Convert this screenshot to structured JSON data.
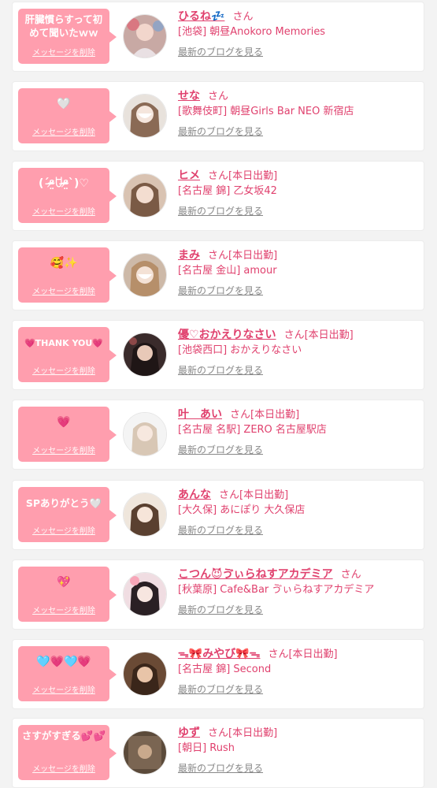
{
  "delete_label": "メッセージを削除",
  "blog_label": "最新のブログを見る",
  "items": [
    {
      "message": "肝臓慣らすって初めて聞いたｗｗ",
      "name": "ひるね💤",
      "status": "さん",
      "shop": "[池袋] 朝昼Anokoro Memories"
    },
    {
      "message": "🤍",
      "name": "せな",
      "status": "さん",
      "shop": "[歌舞伎町] 朝昼Girls Bar NEO 新宿店"
    },
    {
      "message": "(ˊᵒ̴̶̷̤ꇴᵒ̴̶̷̤ˋ)♡",
      "name": "ヒメ",
      "status": "さん[本日出勤]",
      "shop": "[名古屋 錦] 乙女坂42"
    },
    {
      "message": "🥰✨",
      "name": "まみ",
      "status": "さん[本日出勤]",
      "shop": "[名古屋 金山] amour"
    },
    {
      "message": "💗THANK YOU💗",
      "name": "優♡おかえりなさい",
      "status": "さん[本日出勤]",
      "shop": "[池袋西口] おかえりなさい"
    },
    {
      "message": "💗",
      "name": "叶　あい",
      "status": "さん[本日出勤]",
      "shop": "[名古屋 名駅] ZERO 名古屋駅店"
    },
    {
      "message": "SPありがとう🤍",
      "name": "あんな",
      "status": "さん[本日出勤]",
      "shop": "[大久保] あにぽり 大久保店"
    },
    {
      "message": "💖",
      "name": "こつん😈ゔぃらねすアカデミア",
      "status": "さん",
      "shop": "[秋葉原] Cafe&Bar ゔぃらねすアカデミア"
    },
    {
      "message": "🩵💗🩵💗",
      "name": "ᯓ🎀みやび🎀ᯓ",
      "status": "さん[本日出勤]",
      "shop": "[名古屋 錦] Second"
    },
    {
      "message": "さすがすぎる💕💕",
      "name": "ゆず",
      "status": "さん[本日出勤]",
      "shop": "[朝日] Rush"
    }
  ]
}
